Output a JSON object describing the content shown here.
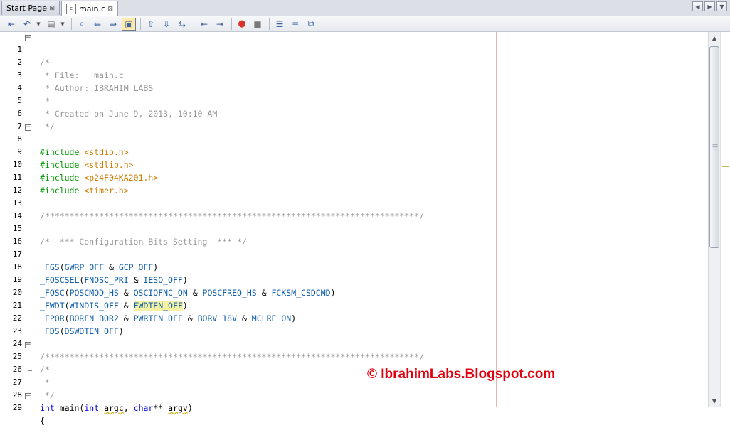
{
  "tabs": {
    "start_page": "Start Page",
    "main_c": "main.c",
    "close_glyph": "×"
  },
  "toolbar": {
    "icons": [
      "back-icon",
      "history-forward-icon",
      "last-edit-icon",
      "find-icon",
      "find-prev-icon",
      "find-next-icon",
      "toggle-highlight-icon",
      "prev-bookmark-icon",
      "next-bookmark-icon",
      "toggle-bookmark-icon",
      "shift-left-icon",
      "shift-right-icon",
      "start-macro-icon",
      "stop-macro-icon",
      "comment-icon",
      "uncomment-icon",
      "diff-icon"
    ]
  },
  "editor": {
    "lines": [
      {
        "n": "1",
        "code": "/*"
      },
      {
        "n": "2",
        "code": " * File:   main.c"
      },
      {
        "n": "3",
        "code": " * Author: IBRAHIM LABS"
      },
      {
        "n": "4",
        "code": " *"
      },
      {
        "n": "5",
        "code": " * Created on June 9, 2013, 10:10 AM"
      },
      {
        "n": "6",
        "code": " */"
      },
      {
        "n": "7",
        "code": ""
      },
      {
        "n": "8",
        "pp": "#include",
        "inc": "<stdio.h>"
      },
      {
        "n": "9",
        "pp": "#include",
        "inc": "<stdlib.h>"
      },
      {
        "n": "10",
        "pp": "#include",
        "inc": "<p24F04KA201.h>"
      },
      {
        "n": "11",
        "pp": "#include",
        "inc": "<timer.h>"
      },
      {
        "n": "12",
        "code": ""
      },
      {
        "n": "13",
        "code": "/****************************************************************************/"
      },
      {
        "n": "14",
        "code": ""
      },
      {
        "n": "15",
        "code": "/*  *** Configuration Bits Setting  *** */"
      },
      {
        "n": "16",
        "code": ""
      },
      {
        "n": "17",
        "m1": "_FGS",
        "a1": "GWRP_OFF",
        "a2": "GCP_OFF"
      },
      {
        "n": "18",
        "m1": "_FOSCSEL",
        "a1": "FNOSC_PRI",
        "a2": "IESO_OFF"
      },
      {
        "n": "19",
        "m1": "_FOSC",
        "a1": "POSCMOD_HS",
        "a2": "OSCIOFNC_ON",
        "a3": "POSCFREQ_HS",
        "a4": "FCKSM_CSDCMD"
      },
      {
        "n": "20",
        "m1": "_FWDT",
        "a1": "WINDIS_OFF",
        "a2": "FWDTEN_OFF"
      },
      {
        "n": "21",
        "m1": "_FPOR",
        "a1": "BOREN_BOR2",
        "a2": "PWRTEN_OFF",
        "a3": "BORV_18V",
        "a4": "MCLRE_ON"
      },
      {
        "n": "22",
        "m1": "_FDS",
        "a1": "DSWDTEN_OFF"
      },
      {
        "n": "23",
        "code": ""
      },
      {
        "n": "24",
        "code": "/****************************************************************************/"
      },
      {
        "n": "25",
        "code": "/*"
      },
      {
        "n": "26",
        "code": " *"
      },
      {
        "n": "27",
        "code": " */"
      },
      {
        "n": "28",
        "kw1": "int",
        "fn": "main",
        "kw2": "int",
        "arg1": "argc",
        "kw3": "char",
        "arg2": "argv"
      },
      {
        "n": "29",
        "code": "{"
      }
    ]
  },
  "watermark": "© IbrahimLabs.Blogspot.com"
}
